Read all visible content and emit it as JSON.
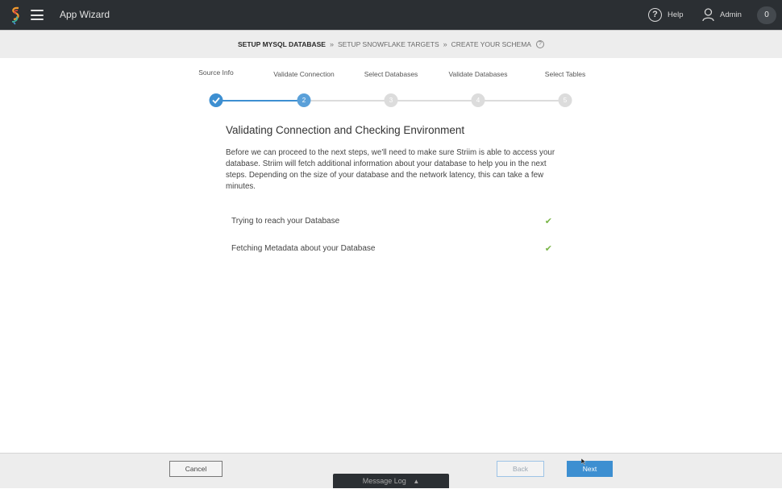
{
  "header": {
    "app_title": "App Wizard",
    "help_label": "Help",
    "user_label": "Admin",
    "notification_count": "0"
  },
  "breadcrumb": {
    "items": [
      {
        "label": "SETUP MYSQL DATABASE",
        "active": true
      },
      {
        "label": "SETUP SNOWFLAKE TARGETS",
        "active": false
      },
      {
        "label": "CREATE YOUR SCHEMA",
        "active": false
      }
    ],
    "separator": "»"
  },
  "stepper": {
    "steps": [
      {
        "label": "Source Info",
        "number": "1",
        "state": "done"
      },
      {
        "label": "Validate Connection",
        "number": "2",
        "state": "current"
      },
      {
        "label": "Select Databases",
        "number": "3",
        "state": "future"
      },
      {
        "label": "Validate Databases",
        "number": "4",
        "state": "future"
      },
      {
        "label": "Select Tables",
        "number": "5",
        "state": "future"
      }
    ]
  },
  "main": {
    "title": "Validating Connection and Checking Environment",
    "description": "Before we can proceed to the next steps, we'll need to make sure Striim is able to access your database. Striim will fetch additional information about your database to help you in the next steps. Depending on the size of your database and the network latency, this can take a few minutes.",
    "checks": [
      {
        "label": "Trying to reach your Database",
        "status": "success"
      },
      {
        "label": "Fetching Metadata about your Database",
        "status": "success"
      }
    ]
  },
  "footer": {
    "cancel_label": "Cancel",
    "back_label": "Back",
    "next_label": "Next",
    "message_log_label": "Message Log"
  },
  "colors": {
    "topbar": "#2b2f33",
    "accent": "#3d8fd1",
    "success": "#7ab648"
  }
}
